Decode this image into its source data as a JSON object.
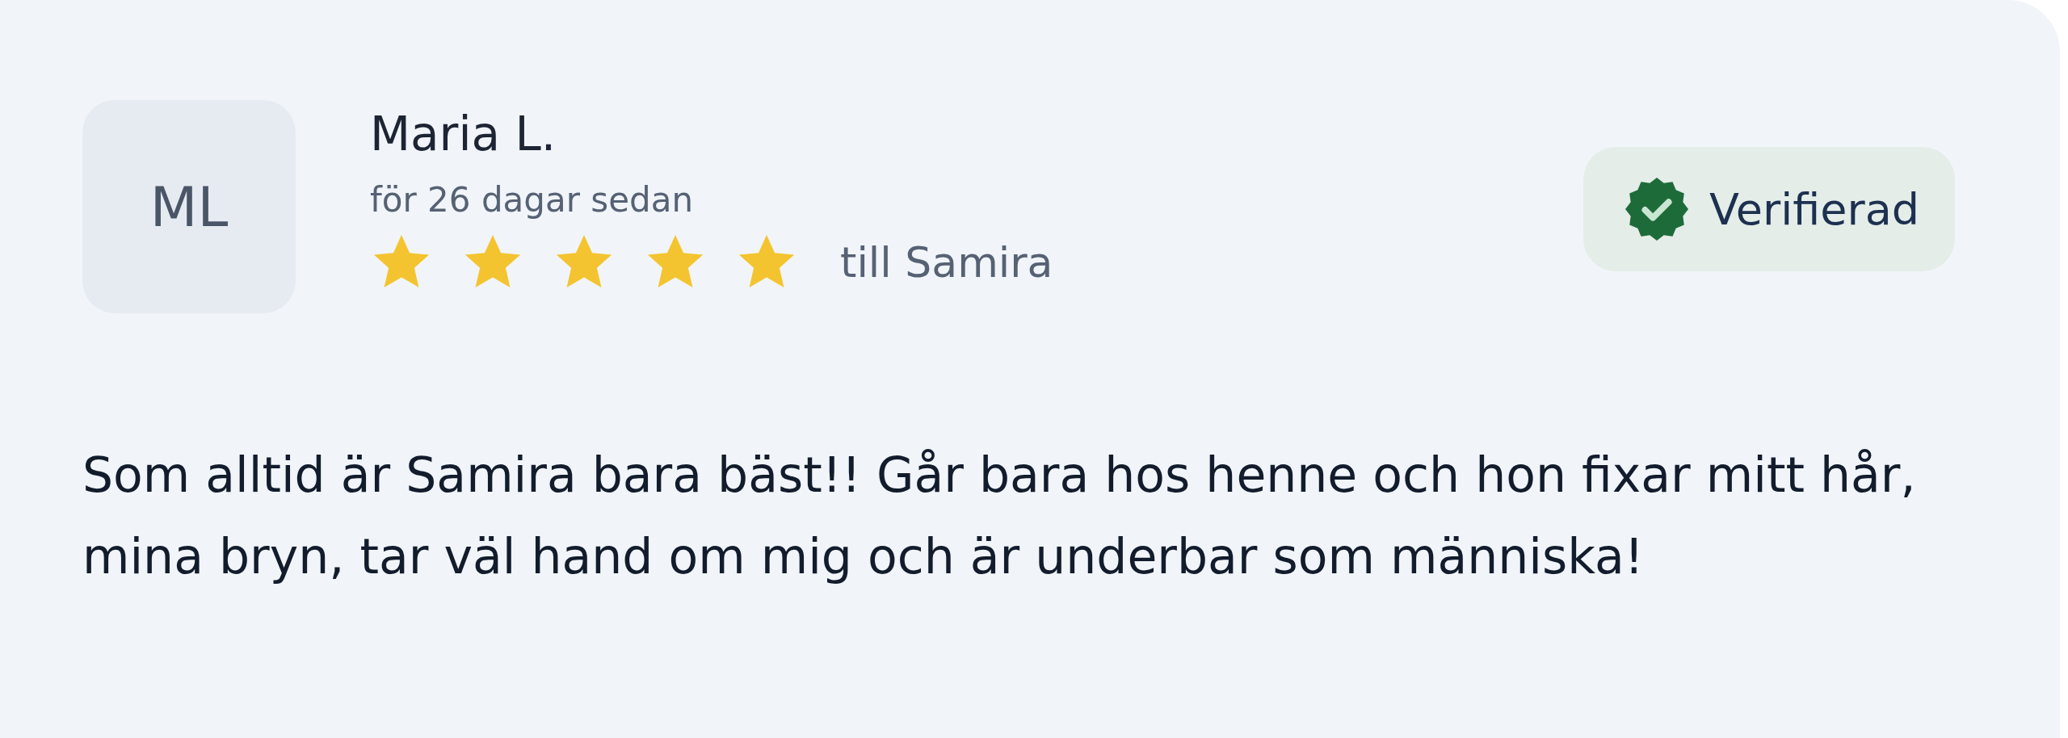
{
  "review": {
    "initials": "ML",
    "author": "Maria L.",
    "time": "för 26 dagar sedan",
    "stars": 5,
    "recipient": "till Samira",
    "verified": true,
    "badge": "Verifierad",
    "text": "Som alltid är Samira bara bäst!! Går bara hos henne och hon fixar mitt hår, mina bryn, tar väl hand om mig och är underbar som människa!"
  }
}
